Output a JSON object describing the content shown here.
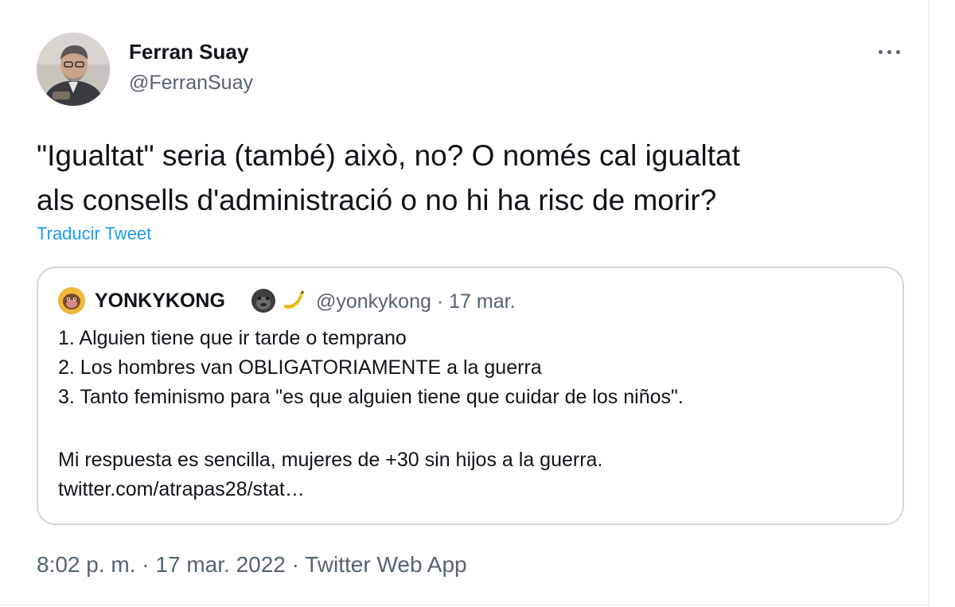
{
  "author": {
    "name": "Ferran Suay",
    "handle": "@FerranSuay"
  },
  "tweet": {
    "lines": [
      "\"Igualtat\" seria (també) això, no? O només cal igualtat",
      "als consells d'administració o no hi ha risc de morir?"
    ],
    "translate_label": "Traducir Tweet"
  },
  "quote": {
    "author_name": "YONKYKONG",
    "author_emojis": [
      "gorilla-icon",
      "banana-icon"
    ],
    "handle_and_date": "@yonkykong · 17 mar.",
    "lines": [
      "1. Alguien tiene que ir tarde o temprano",
      "2. Los hombres van OBLIGATORIAMENTE a la guerra",
      "3. Tanto feminismo para \"es que alguien tiene que cuidar de los niños\".",
      "",
      "Mi respuesta es sencilla, mujeres de +30 sin hijos a la guerra.",
      "twitter.com/atrapas28/stat…"
    ]
  },
  "meta": {
    "time": "8:02 p. m.",
    "separator": " · ",
    "date": "17 mar. 2022",
    "source": "Twitter Web App"
  },
  "colors": {
    "text": "#0f1419",
    "secondary": "#536471",
    "link": "#1d9bf0",
    "border": "#cfd9de"
  }
}
